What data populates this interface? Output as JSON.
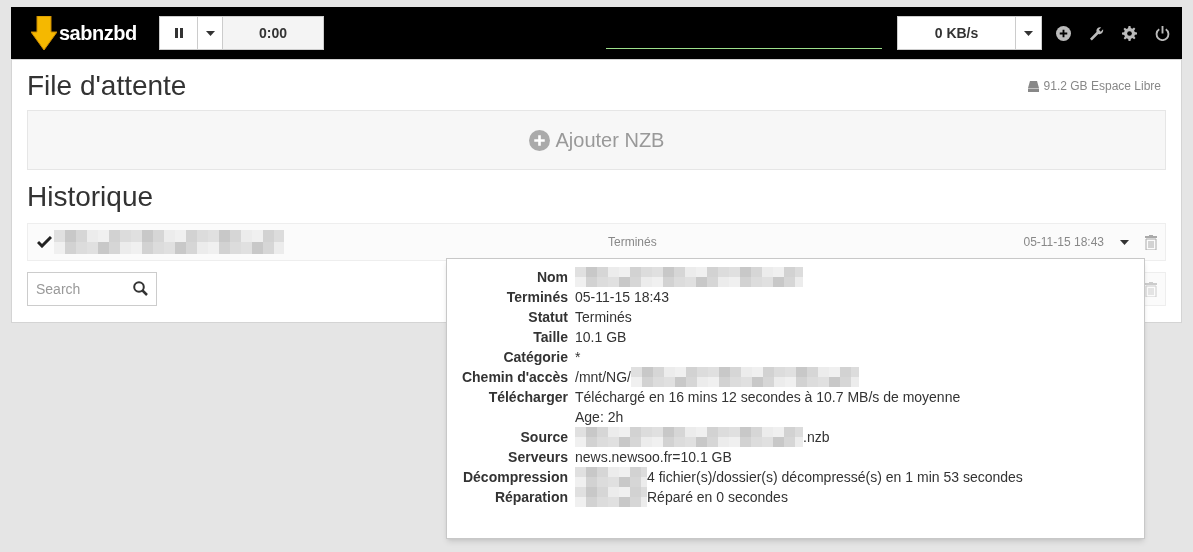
{
  "navbar": {
    "logo": "sabnzbd",
    "timer": "0:00",
    "speed": "0 KB/s"
  },
  "queue": {
    "title": "File d'attente",
    "free_space": "91.2 GB Espace Libre",
    "add_button": "Ajouter NZB"
  },
  "history": {
    "title": "Historique",
    "rows": [
      {
        "done": true,
        "status": "Terminés",
        "date": "05-11-15 18:43"
      }
    ],
    "search": {
      "placeholder": "Search"
    }
  },
  "details": [
    {
      "label": "Nom",
      "lines": [
        [
          {
            "kind": "blurred"
          }
        ]
      ]
    },
    {
      "label": "Terminés",
      "lines": [
        [
          {
            "kind": "text",
            "text": "05-11-15 18:43"
          }
        ]
      ]
    },
    {
      "label": "Statut",
      "lines": [
        [
          {
            "kind": "text",
            "text": "Terminés"
          }
        ]
      ]
    },
    {
      "label": "Taille",
      "lines": [
        [
          {
            "kind": "text",
            "text": "10.1 GB"
          }
        ]
      ]
    },
    {
      "label": "Catégorie",
      "lines": [
        [
          {
            "kind": "text",
            "text": "*"
          }
        ]
      ]
    },
    {
      "label": "Chemin d'accès",
      "lines": [
        [
          {
            "kind": "text",
            "text": "/mnt/NG/"
          },
          {
            "kind": "blurred"
          }
        ]
      ]
    },
    {
      "label": "Télécharger",
      "lines": [
        [
          {
            "kind": "text",
            "text": "Téléchargé en 16 mins 12 secondes à 10.7 MB/s de moyenne"
          }
        ],
        [
          {
            "kind": "text",
            "text": "Age: 2h"
          }
        ]
      ]
    },
    {
      "label": "Source",
      "lines": [
        [
          {
            "kind": "blurred"
          },
          {
            "kind": "text",
            "text": ".nzb"
          }
        ]
      ]
    },
    {
      "label": "Serveurs",
      "lines": [
        [
          {
            "kind": "text",
            "text": "news.newsoo.fr=10.1 GB"
          }
        ]
      ]
    },
    {
      "label": "Décompression",
      "lines": [
        [
          {
            "kind": "smudge"
          },
          {
            "kind": "text",
            "text": "4 fichier(s)/dossier(s) décompressé(s) en 1 min 53 secondes"
          }
        ]
      ]
    },
    {
      "label": "Réparation",
      "lines": [
        [
          {
            "kind": "smudge"
          },
          {
            "kind": "text",
            "text": "Réparé en 0 secondes"
          }
        ]
      ]
    }
  ]
}
